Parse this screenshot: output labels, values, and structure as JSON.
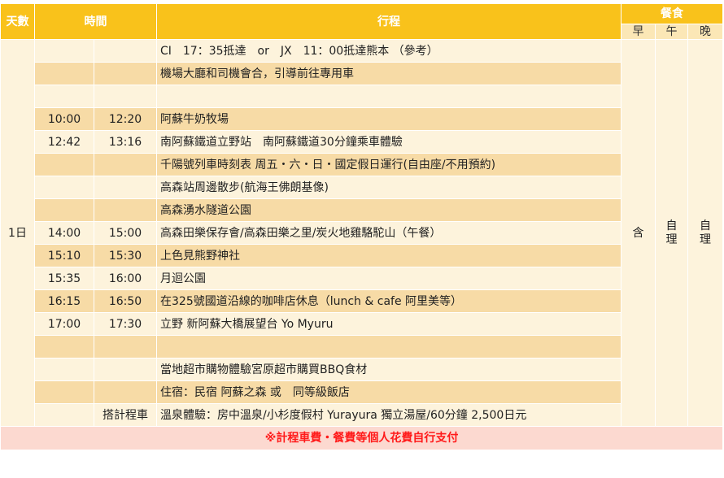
{
  "header": {
    "day": "天數",
    "time": "時間",
    "itinerary": "行程",
    "meals": "餐食",
    "breakfast": "早",
    "lunch": "午",
    "dinner": "晚"
  },
  "day_label": "1日",
  "meals": {
    "breakfast": "含",
    "lunch": "自理",
    "dinner": "自理"
  },
  "rows": [
    {
      "start": "",
      "end": "",
      "activity": "CI　17：35抵達　or　JX　11：00抵達熊本 （參考）"
    },
    {
      "start": "",
      "end": "",
      "activity": "機場大廳和司機會合，引導前往專用車"
    },
    {
      "start": "",
      "end": "",
      "activity": ""
    },
    {
      "start": "10:00",
      "end": "12:20",
      "activity": "阿蘇牛奶牧場"
    },
    {
      "start": "12:42",
      "end": "13:16",
      "activity": "南阿蘇鐵道立野站　南阿蘇鐵道30分鐘乘車體驗"
    },
    {
      "start": "",
      "end": "",
      "activity": "千陽號列車時刻表 周五・六・日・國定假日運行(自由座/不用預約)"
    },
    {
      "start": "",
      "end": "",
      "activity": "高森站周邊散步(航海王佛朗基像)"
    },
    {
      "start": "",
      "end": "",
      "activity": "高森湧水隧道公園"
    },
    {
      "start": "14:00",
      "end": "15:00",
      "activity": "高森田樂保存會/高森田樂之里/炭火地雞駱駝山（午餐）"
    },
    {
      "start": "15:10",
      "end": "15:30",
      "activity": "上色見熊野神社"
    },
    {
      "start": "15:35",
      "end": "16:00",
      "activity": "月迴公園"
    },
    {
      "start": "16:15",
      "end": "16:50",
      "activity": "在325號國道沿線的咖啡店休息（lunch & cafe 阿里美等）"
    },
    {
      "start": "17:00",
      "end": "17:30",
      "activity": "立野 新阿蘇大橋展望台 Yo Myuru"
    },
    {
      "start": "",
      "end": "",
      "activity": ""
    },
    {
      "start": "",
      "end": "",
      "activity": "當地超市購物體驗宮原超市購買BBQ食材"
    },
    {
      "start": "",
      "end": "",
      "activity": "住宿：民宿 阿蘇之森 或　同等級飯店"
    },
    {
      "start": "",
      "end": "搭計程車",
      "activity": "溫泉體驗：房中溫泉/小杉度假村 Yurayura 獨立湯屋/60分鐘 2,500日元"
    }
  ],
  "footer_note": "※計程車費・餐費等個人花費自行支付"
}
